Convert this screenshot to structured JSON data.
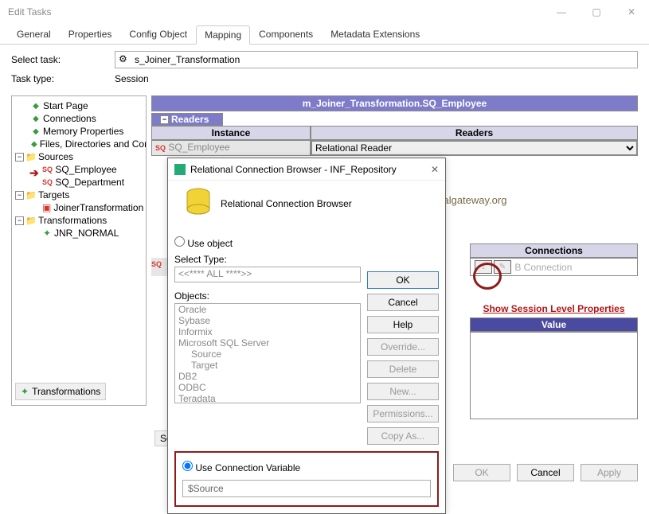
{
  "window": {
    "title": "Edit Tasks"
  },
  "tabs": {
    "t0": "General",
    "t1": "Properties",
    "t2": "Config Object",
    "t3": "Mapping",
    "t4": "Components",
    "t5": "Metadata Extensions"
  },
  "form": {
    "select_task_label": "Select task:",
    "task_type_label": "Task type:",
    "selected_task": "s_Joiner_Transformation",
    "task_type_value": "Session"
  },
  "tree": {
    "start_page": "Start Page",
    "connections": "Connections",
    "memory_props": "Memory Properties",
    "files_dirs": "Files, Directories and Commands",
    "sources": "Sources",
    "sq_emp": "SQ_Employee",
    "sq_dept": "SQ_Department",
    "targets": "Targets",
    "joiner_tgt": "JoinerTransformation",
    "transformations": "Transformations",
    "jnr_normal": "JNR_NORMAL",
    "footer_btn": "Transformations"
  },
  "mapping": {
    "header": "m_Joiner_Transformation.SQ_Employee",
    "readers_section": "Readers",
    "col_instance": "Instance",
    "col_readers": "Readers",
    "sq_prefix": "SQ",
    "sq_instance": "SQ_Employee",
    "readers_value": "Relational Reader",
    "connections_header": "Connections",
    "sq_prefix2": "SQ",
    "bconn_text": "B Connection",
    "show_sess_link": "Show Session Level Properties",
    "value_header": "Value",
    "sources_footer": "Sources"
  },
  "dialog": {
    "title": "Relational Connection Browser - INF_Repository",
    "subtitle": "Relational Connection Browser",
    "use_object": "Use object",
    "select_type_label": "Select Type:",
    "select_type_value": "<<**** ALL ****>>",
    "objects_label": "Objects:",
    "obj": [
      "Oracle",
      "Sybase",
      "Informix",
      "Microsoft SQL Server",
      "Source",
      "Target",
      "DB2",
      "ODBC",
      "Teradata"
    ],
    "btn_ok": "OK",
    "btn_cancel": "Cancel",
    "btn_help": "Help",
    "btn_override": "Override...",
    "btn_delete": "Delete",
    "btn_new": "New...",
    "btn_perm": "Permissions...",
    "btn_copy": "Copy As...",
    "use_conn_var": "Use Connection Variable",
    "conn_var_value": "$Source"
  },
  "footer": {
    "ok": "OK",
    "cancel": "Cancel",
    "apply": "Apply"
  },
  "watermark": "©tutorialgateway.org"
}
